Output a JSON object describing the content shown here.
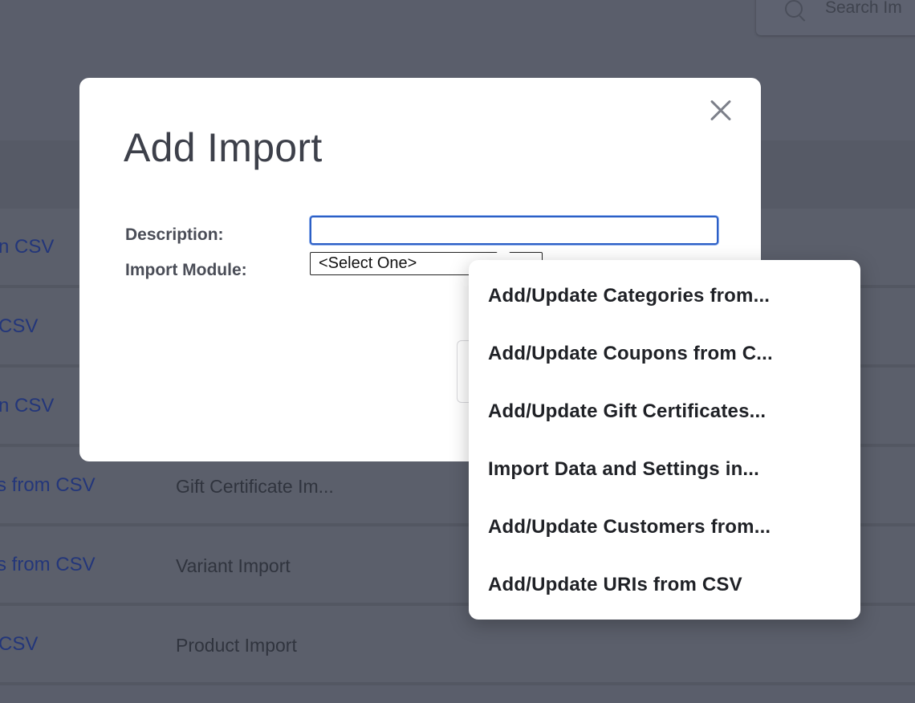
{
  "background": {
    "search_placeholder": "Search Im",
    "rows": [
      {
        "name": "n CSV",
        "type": ""
      },
      {
        "name": "CSV",
        "type": ""
      },
      {
        "name": "n CSV",
        "type": ""
      },
      {
        "name": "s from CSV",
        "type": "Gift Certificate Im..."
      },
      {
        "name": "s from CSV",
        "type": "Variant Import"
      },
      {
        "name": "CSV",
        "type": "Product Import"
      }
    ]
  },
  "modal": {
    "title": "Add Import",
    "description_label": "Description:",
    "description_value": "",
    "module_label": "Import Module:",
    "module_selected": "<Select One>"
  },
  "dropdown": {
    "options": [
      "Add/Update Categories from...",
      "Add/Update Coupons from C...",
      "Add/Update Gift Certificates...",
      "Import Data and Settings in...",
      "Add/Update Customers from...",
      "Add/Update URIs from CSV"
    ]
  },
  "colors": {
    "overlay": "#5a5e6b",
    "link": "#23367a",
    "focus_border": "#2c5fc6"
  }
}
